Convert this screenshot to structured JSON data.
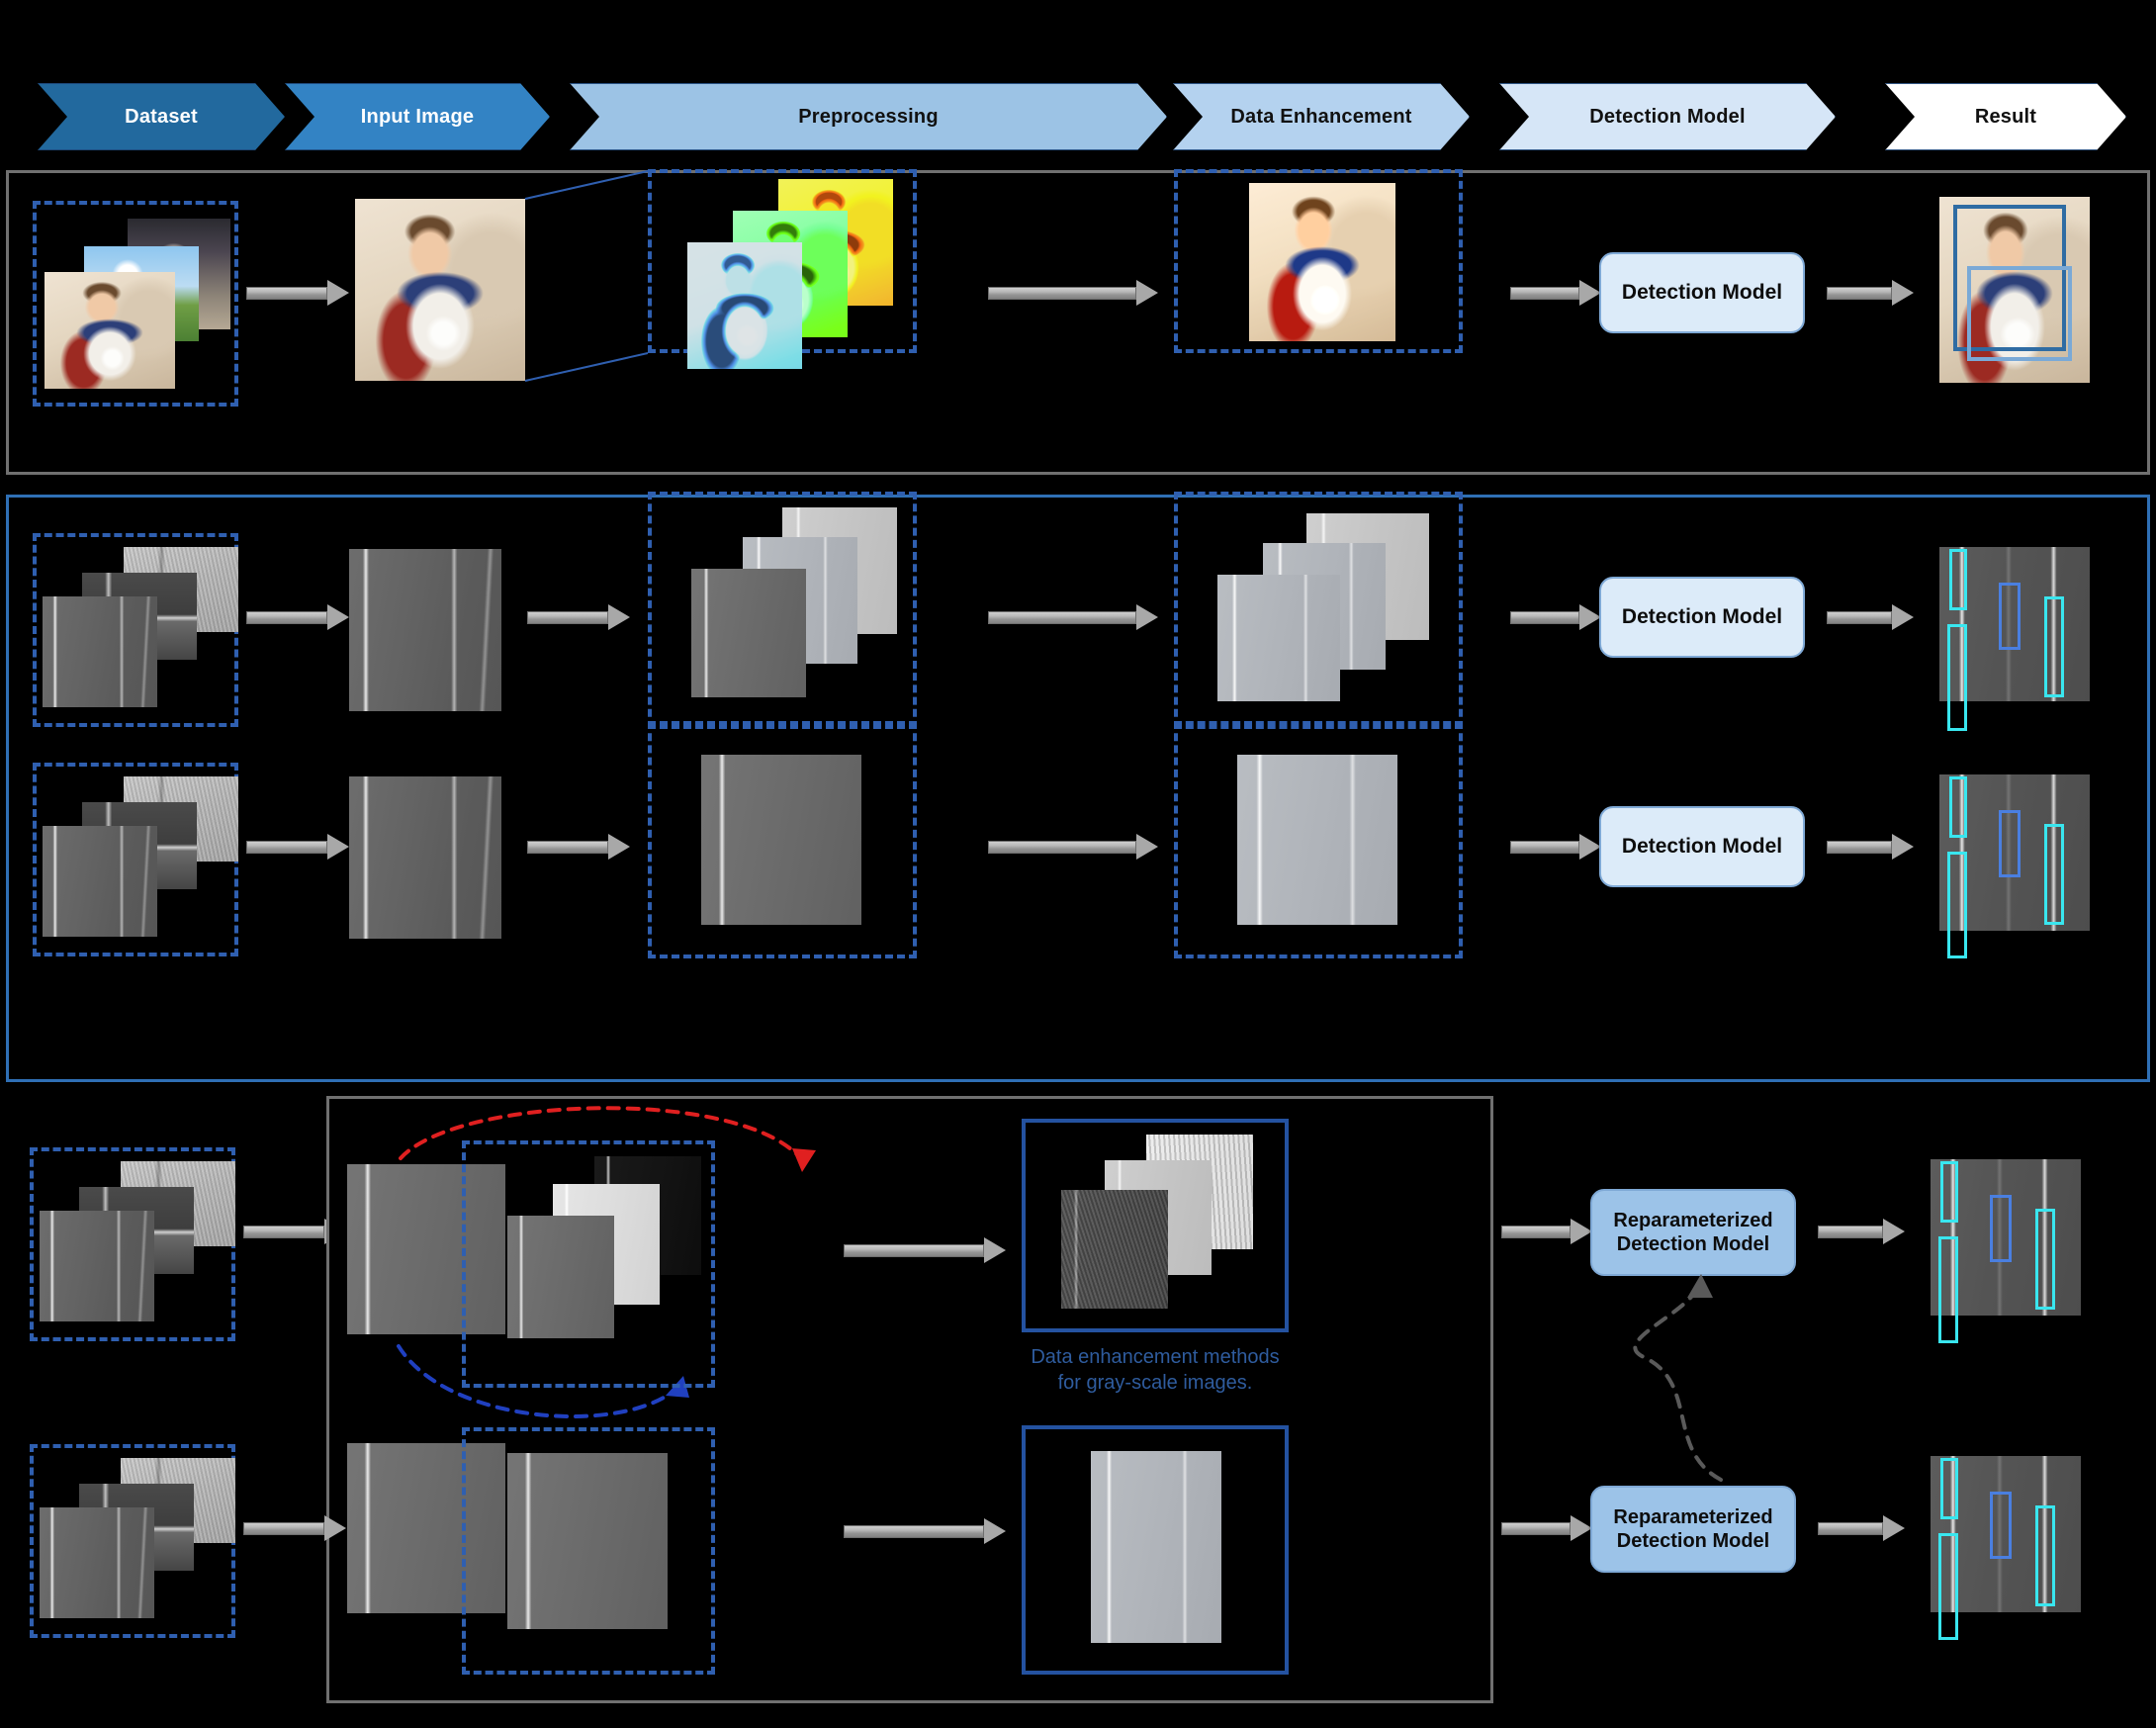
{
  "header": {
    "stages": [
      {
        "label": "Dataset",
        "tone": "c1"
      },
      {
        "label": "Input Image",
        "tone": "c2"
      },
      {
        "label": "Preprocessing",
        "tone": "c3"
      },
      {
        "label": "Data Enhancement",
        "tone": "c4"
      },
      {
        "label": "Detection Model",
        "tone": "c5"
      },
      {
        "label": "Result",
        "tone": "c6"
      }
    ]
  },
  "rows": {
    "row_color": {
      "model_label": "Detection Model"
    },
    "row_gray_multi": {
      "model_label": "Detection Model"
    },
    "row_gray_single": {
      "model_label": "Detection Model"
    },
    "row_reparam_multi": {
      "model_label": "Reparameterized Detection Model"
    },
    "row_reparam_single": {
      "model_label": "Reparameterized Detection Model"
    }
  },
  "captions": {
    "gray_enhancement": "Data enhancement methods for gray-scale images."
  },
  "colors": {
    "chevron_dark": "#22699e",
    "chevron_mid": "#3383c4",
    "chevron_light": "#9cc3e5",
    "roi_dashed": "#2f5fb0",
    "roi_solid": "#2452a0",
    "panel_gray": "#707070",
    "panel_blue": "#2f6fb5",
    "arrow_red": "#e02020",
    "arrow_green": "#6aa52a",
    "arrow_blue": "#2040c0",
    "bbox_cyan": "#39e6ef",
    "bbox_blue": "#4a7fe0",
    "caption_text": "#2f5c9e"
  }
}
